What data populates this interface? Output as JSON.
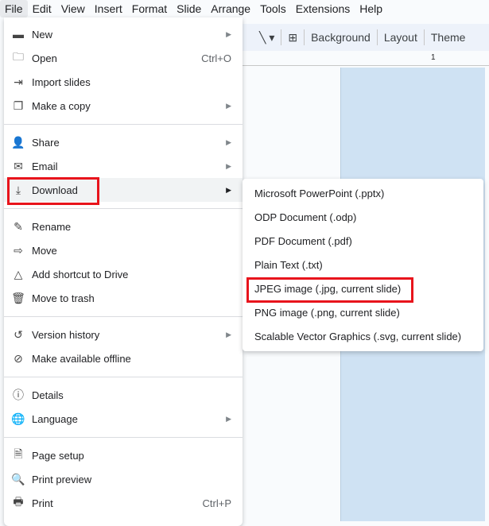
{
  "menubar": [
    "File",
    "Edit",
    "View",
    "Insert",
    "Format",
    "Slide",
    "Arrange",
    "Tools",
    "Extensions",
    "Help"
  ],
  "toolbar": {
    "background": "Background",
    "layout": "Layout",
    "theme": "Theme"
  },
  "ruler": {
    "mark": "1"
  },
  "file_menu": {
    "groups": [
      [
        {
          "label": "New",
          "icon": "new-slides-icon",
          "glyph": "▬",
          "submenu": true
        },
        {
          "label": "Open",
          "icon": "folder-icon",
          "glyph": "🗀",
          "shortcut": "Ctrl+O"
        },
        {
          "label": "Import slides",
          "icon": "import-icon",
          "glyph": "⇥"
        },
        {
          "label": "Make a copy",
          "icon": "copy-icon",
          "glyph": "❐",
          "submenu": true
        }
      ],
      [
        {
          "label": "Share",
          "icon": "person-add-icon",
          "glyph": "👤",
          "submenu": true
        },
        {
          "label": "Email",
          "icon": "email-icon",
          "glyph": "✉",
          "submenu": true
        },
        {
          "label": "Download",
          "icon": "download-icon",
          "glyph": "⤓",
          "submenu": true,
          "highlighted": true
        }
      ],
      [
        {
          "label": "Rename",
          "icon": "pencil-icon",
          "glyph": "✎"
        },
        {
          "label": "Move",
          "icon": "move-folder-icon",
          "glyph": "⇨"
        },
        {
          "label": "Add shortcut to Drive",
          "icon": "drive-shortcut-icon",
          "glyph": "△"
        },
        {
          "label": "Move to trash",
          "icon": "trash-icon",
          "glyph": "🗑"
        }
      ],
      [
        {
          "label": "Version history",
          "icon": "history-icon",
          "glyph": "↺",
          "submenu": true
        },
        {
          "label": "Make available offline",
          "icon": "offline-icon",
          "glyph": "⊘"
        }
      ],
      [
        {
          "label": "Details",
          "icon": "info-icon",
          "glyph": "ⓘ"
        },
        {
          "label": "Language",
          "icon": "globe-icon",
          "glyph": "🌐",
          "submenu": true
        }
      ],
      [
        {
          "label": "Page setup",
          "icon": "page-icon",
          "glyph": "🗎"
        },
        {
          "label": "Print preview",
          "icon": "print-preview-icon",
          "glyph": "🔍"
        },
        {
          "label": "Print",
          "icon": "printer-icon",
          "glyph": "🖶",
          "shortcut": "Ctrl+P"
        }
      ]
    ]
  },
  "download_submenu": [
    "Microsoft PowerPoint (.pptx)",
    "ODP Document (.odp)",
    "PDF Document (.pdf)",
    "Plain Text (.txt)",
    "JPEG image (.jpg, current slide)",
    "PNG image (.png, current slide)",
    "Scalable Vector Graphics (.svg, current slide)"
  ],
  "colors": {
    "highlight_box": "#e8141c",
    "slide": "#cfe2f3"
  }
}
